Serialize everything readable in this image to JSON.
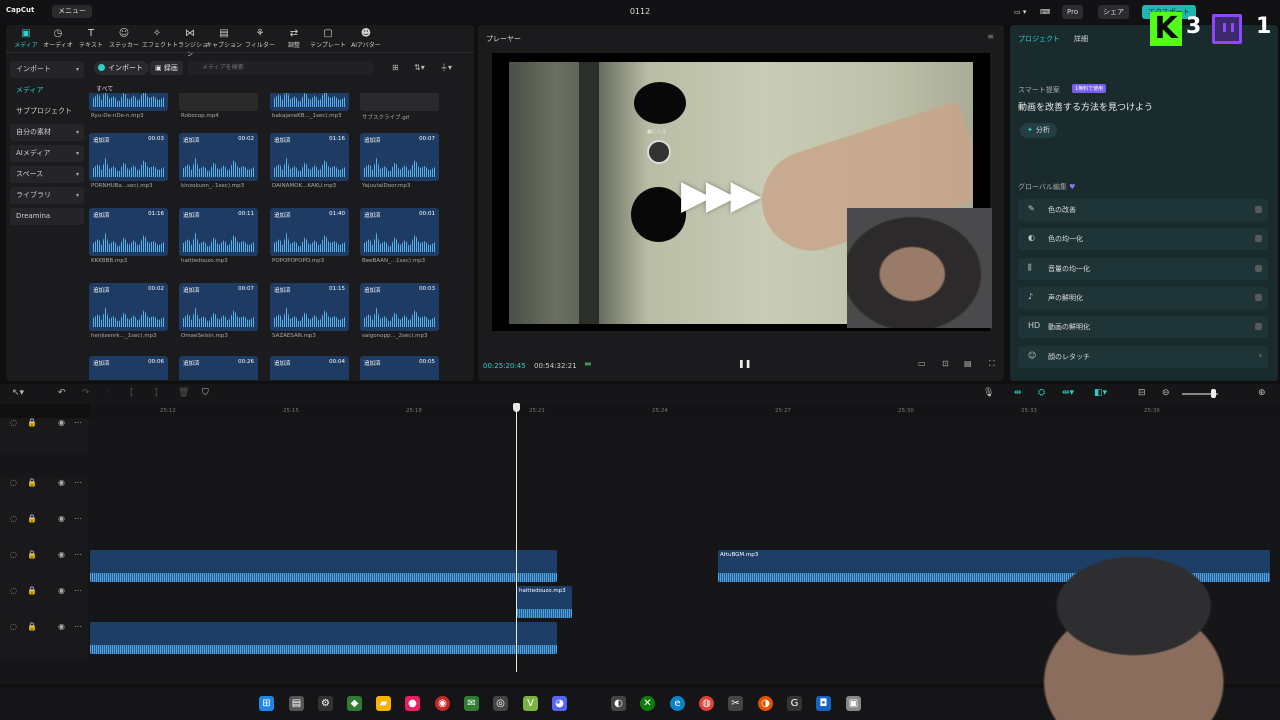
{
  "titlebar": {
    "logo": "CapCut",
    "menu": "メニュー",
    "title": "0112",
    "pro": "Pro",
    "share": "シェア",
    "export": "エクスポート"
  },
  "tool_tabs": [
    {
      "label": "メディア",
      "icon": "media-icon"
    },
    {
      "label": "オーディオ",
      "icon": "audio-icon"
    },
    {
      "label": "テキスト",
      "icon": "text-icon"
    },
    {
      "label": "ステッカー",
      "icon": "sticker-icon"
    },
    {
      "label": "エフェクト",
      "icon": "effect-icon"
    },
    {
      "label": "トランジション",
      "icon": "transition-icon"
    },
    {
      "label": "キャプション",
      "icon": "caption-icon"
    },
    {
      "label": "フィルター",
      "icon": "filter-icon"
    },
    {
      "label": "調整",
      "icon": "adjust-icon"
    },
    {
      "label": "テンプレート",
      "icon": "template-icon"
    },
    {
      "label": "AIアバター",
      "icon": "ai-avatar-icon"
    }
  ],
  "side_nav": [
    {
      "label": "インポート",
      "boxed": true
    },
    {
      "label": "メディア",
      "active": true
    },
    {
      "label": "サブプロジェクト"
    },
    {
      "label": "自分の素材",
      "boxed": true
    },
    {
      "label": "AIメディア",
      "boxed": true
    },
    {
      "label": "スペース",
      "boxed": true
    },
    {
      "label": "ライブラリ",
      "boxed": true
    },
    {
      "label": "Dreamina",
      "boxed": true
    }
  ],
  "media_toolbar": {
    "import_tab": "インポート",
    "record_tab": "録画",
    "search_placeholder": "メディアを検索"
  },
  "media_all_label": "すべて",
  "media_items": [
    {
      "name": "Ryu-De-nDe-n.mp3",
      "add": "",
      "duration": ""
    },
    {
      "name": "Robocop.mp4",
      "add": "",
      "duration": ""
    },
    {
      "name": "bakajaneKB..._1sec).mp3",
      "add": "",
      "duration": ""
    },
    {
      "name": "サブスクライブ.gif",
      "add": "",
      "duration": ""
    },
    {
      "name": "PORNHUBa...sec).mp3",
      "add": "追加済",
      "duration": "00:03"
    },
    {
      "name": "kinzokuon_..1sec).mp3",
      "add": "追加済",
      "duration": "00:02"
    },
    {
      "name": "DAINAMOK...KAKU.mp3",
      "add": "追加済",
      "duration": "01:16"
    },
    {
      "name": "YajuutaiDoor.mp3",
      "add": "追加済",
      "duration": "00:07"
    },
    {
      "name": "KKKBBB.mp3",
      "add": "追加済",
      "duration": "01:16"
    },
    {
      "name": "haittedouzo.mp3",
      "add": "追加済",
      "duration": "00:11"
    },
    {
      "name": "POPOPOPOPO.mp3",
      "add": "追加済",
      "duration": "01:40"
    },
    {
      "name": "BeeBAAN_...1sec).mp3",
      "add": "追加済",
      "duration": "00:01"
    },
    {
      "name": "henjisenrk..._1sec).mp3",
      "add": "追加済",
      "duration": "00:02"
    },
    {
      "name": "OmaeSeisin.mp3",
      "add": "追加済",
      "duration": "00:07"
    },
    {
      "name": "SAZAESAN.mp3",
      "add": "追加済",
      "duration": "01:15"
    },
    {
      "name": "saigonopp..._2sec).mp3",
      "add": "追加済",
      "duration": "00:03"
    },
    {
      "name": "",
      "add": "追加済",
      "duration": "00:06"
    },
    {
      "name": "",
      "add": "追加済",
      "duration": "00:26"
    },
    {
      "name": "",
      "add": "追加済",
      "duration": "00:04"
    },
    {
      "name": "",
      "add": "追加済",
      "duration": "00:05"
    }
  ],
  "player": {
    "title": "プレーヤー",
    "time_current": "00:25:20:45",
    "time_total": "00:54:32:21",
    "overlay_text": "■に入る"
  },
  "right_panel": {
    "tab_project": "プロジェクト",
    "tab_detail": "詳細",
    "smart_label": "スマート提案",
    "smart_badge": "1無料で使用",
    "smart_headline": "動画を改善する方法を見つけよう",
    "analyze": "分析",
    "global_label": "グローバル編集",
    "items": [
      {
        "icon": "color-improve-icon",
        "label": "色の改善"
      },
      {
        "icon": "color-match-icon",
        "label": "色の均一化"
      },
      {
        "icon": "volume-normalize-icon",
        "label": "音量の均一化"
      },
      {
        "icon": "voice-enhance-icon",
        "label": "声の鮮明化"
      },
      {
        "icon": "hd-icon",
        "label": "動画の鮮明化"
      },
      {
        "icon": "face-retouch-icon",
        "label": "顔のレタッチ"
      }
    ]
  },
  "timeline": {
    "ruler_ticks": [
      "25:12",
      "25:15",
      "25:18",
      "25:21",
      "25:24",
      "25:27",
      "25:30",
      "25:33",
      "25:36"
    ],
    "clips": [
      {
        "name": "AttuBGM.mp3"
      },
      {
        "name": "haittedouzo.mp3"
      }
    ]
  },
  "overlays": {
    "kick_letter": "K",
    "kick_count": "3",
    "twitch_count": "1"
  },
  "colors": {
    "accent": "#2fd0c8",
    "clip_blue": "#1d3e66",
    "kick_green": "#53fc18",
    "twitch_purple": "#9146ff"
  }
}
